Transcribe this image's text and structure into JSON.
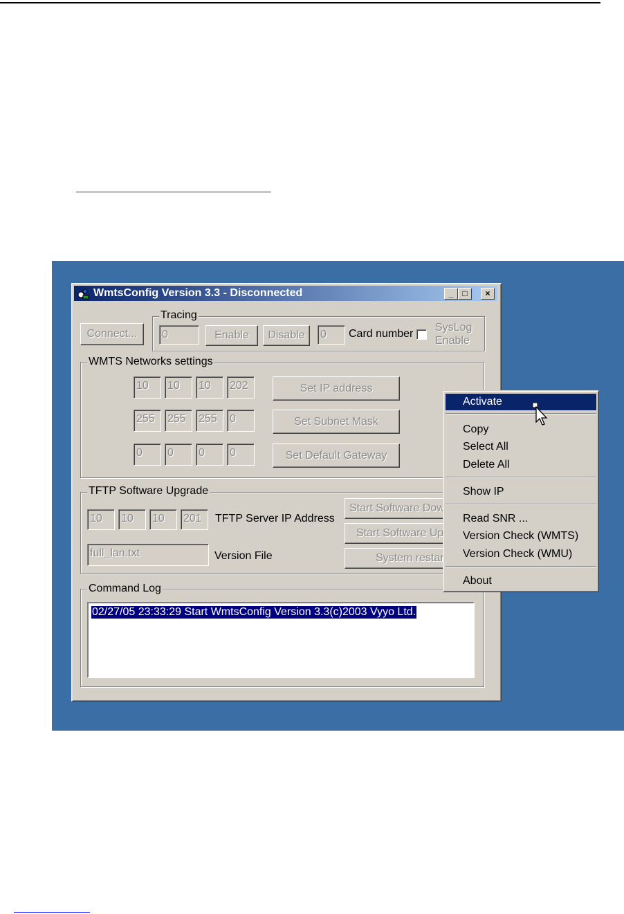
{
  "window": {
    "title": "WmtsConfig Version 3.3 - Disconnected",
    "min_glyph": "_",
    "max_glyph": "□",
    "close_glyph": "×"
  },
  "top": {
    "connect_label": "Connect...",
    "tracing_group": "Tracing",
    "tracing_value": "0",
    "enable_label": "Enable",
    "disable_label": "Disable",
    "card_value": "0",
    "card_label": "Card number",
    "syslog_line1": "SysLog",
    "syslog_line2": "Enable"
  },
  "wmts": {
    "group_label": "WMTS Networks settings",
    "ip": [
      "10",
      "10",
      "10",
      "202"
    ],
    "mask": [
      "255",
      "255",
      "255",
      "0"
    ],
    "gateway": [
      "0",
      "0",
      "0",
      "0"
    ],
    "set_ip_label": "Set IP address",
    "set_mask_label": "Set Subnet Mask",
    "set_gateway_label": "Set Default Gateway"
  },
  "tftp": {
    "group_label": "TFTP Software Upgrade",
    "server_ip": [
      "10",
      "10",
      "10",
      "201"
    ],
    "server_ip_label": "TFTP Server IP Address",
    "version_file_value": "full_lan.txt",
    "version_file_label": "Version File",
    "start_download_label": "Start Software Dow",
    "start_upgrade_label": "Start Software Up",
    "system_restart_label": "System restar"
  },
  "log": {
    "group_label": "Command Log",
    "lines": [
      "02/27/05 23:33:29 Start WmtsConfig Version 3.3(c)2003 Vyyo Ltd."
    ]
  },
  "context_menu": {
    "items": [
      {
        "label": "Activate"
      },
      {
        "label": "Copy"
      },
      {
        "label": "Select All"
      },
      {
        "label": "Delete All"
      },
      {
        "label": "Show IP"
      },
      {
        "label": "Read SNR ..."
      },
      {
        "label": "Version Check (WMTS)"
      },
      {
        "label": "Version Check (WMU)"
      },
      {
        "label": "About"
      }
    ]
  },
  "colors": {
    "desktop": "#3a6ea5",
    "title_start": "#0a246a",
    "title_end": "#a6caf0",
    "face": "#d4d0c8",
    "highlight": "#0a246a"
  }
}
